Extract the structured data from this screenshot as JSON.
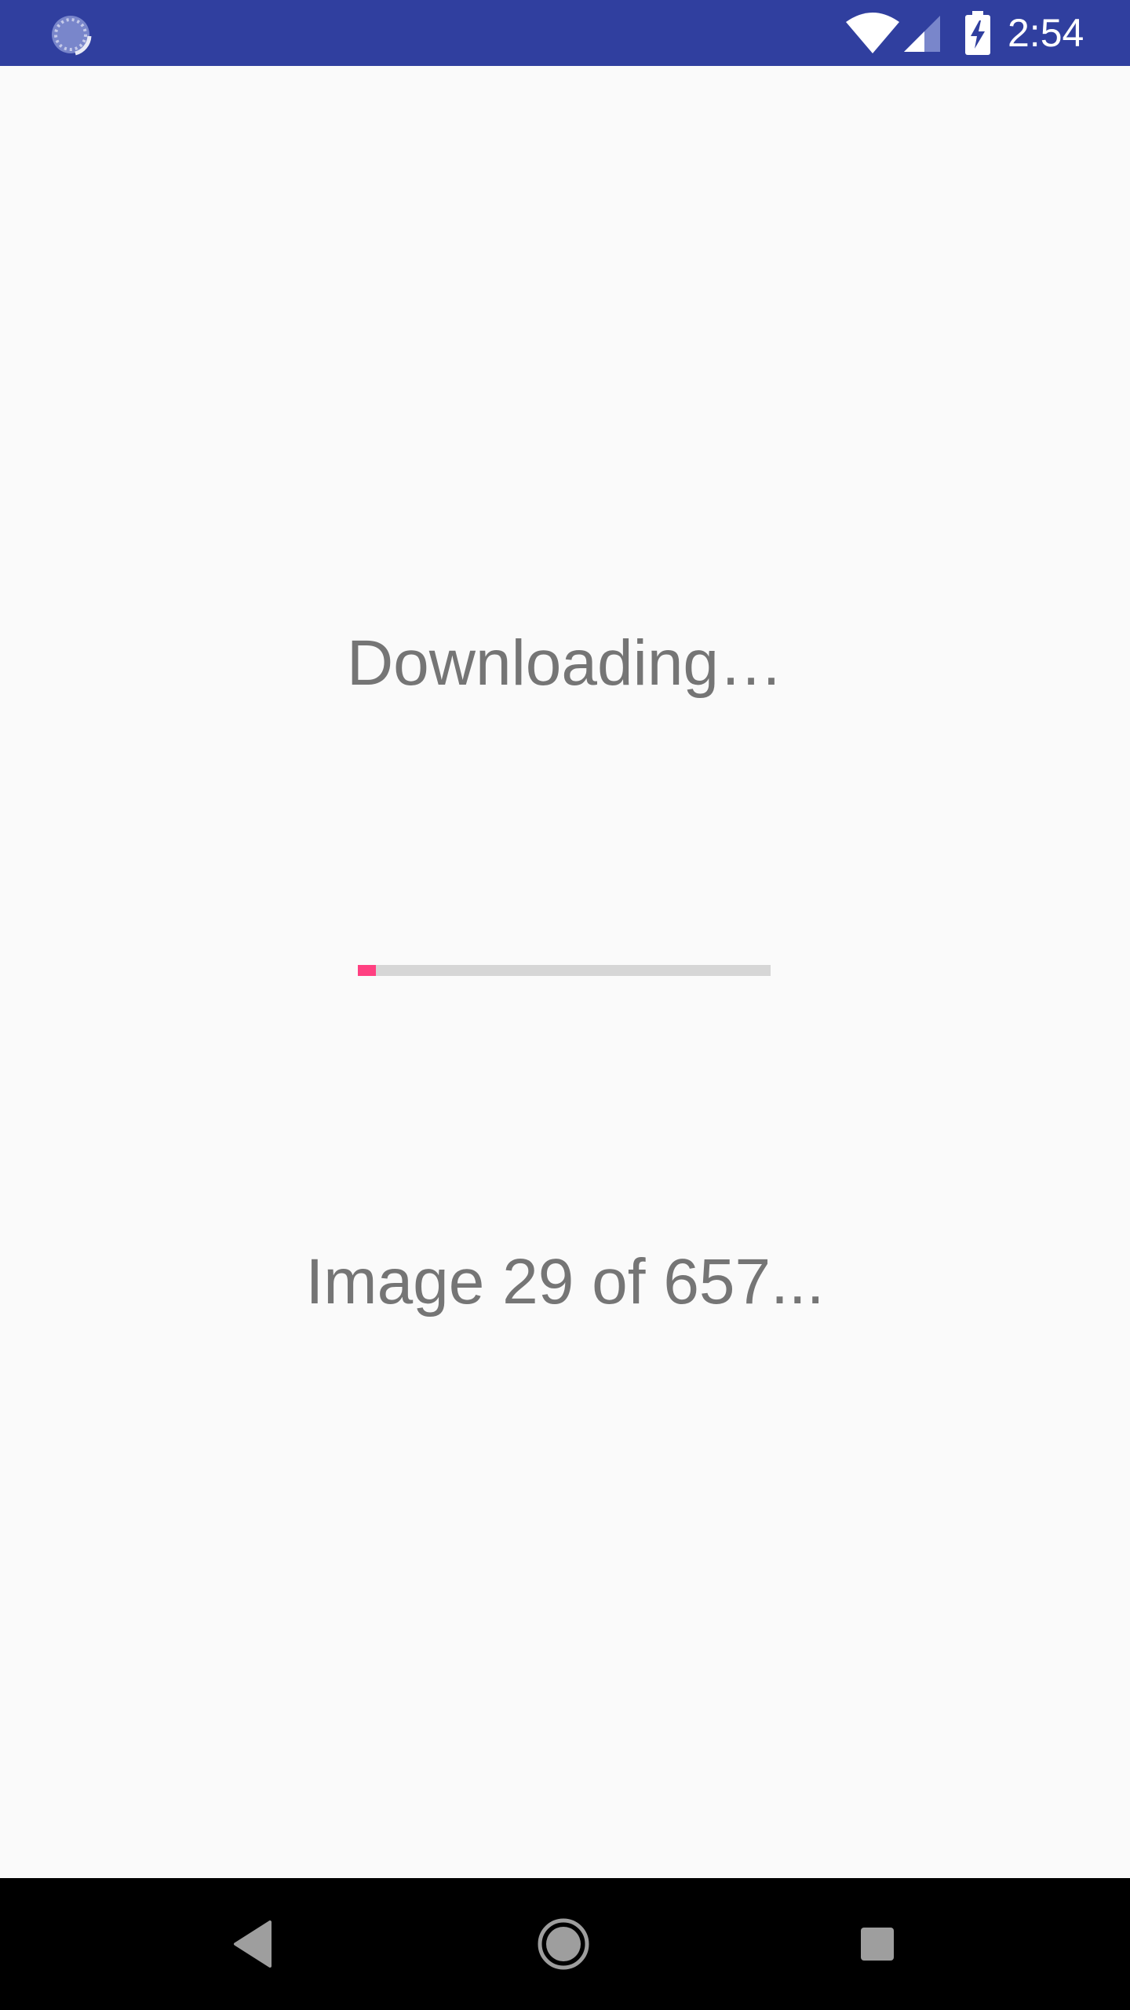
{
  "status_bar": {
    "time": "2:54",
    "background_color": "#303f9f",
    "icons": [
      "sync-icon",
      "wifi-icon",
      "cellular-signal-icon",
      "battery-charging-icon"
    ]
  },
  "main": {
    "title": "Downloading…",
    "progress": {
      "fraction": 0.044,
      "fill_color": "#ff4081",
      "track_color": "#d6d6d6"
    },
    "status_text": "Image 29 of 657..."
  },
  "nav_bar": {
    "buttons": [
      "back-icon",
      "home-icon",
      "recents-icon"
    ]
  }
}
